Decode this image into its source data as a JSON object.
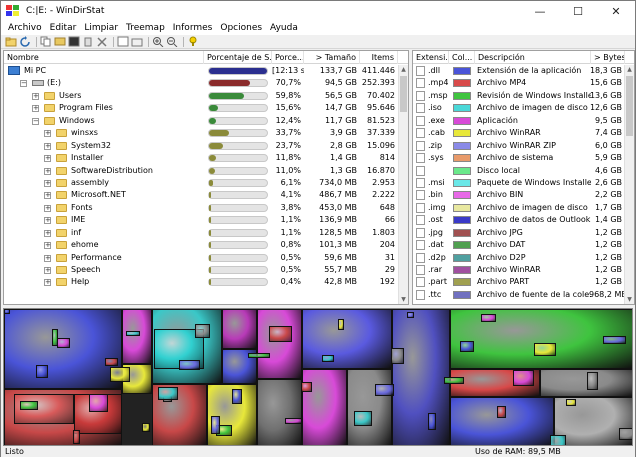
{
  "window": {
    "title": "C:|E: - WinDirStat",
    "minimize": "—",
    "maximize": "☐",
    "close": "✕"
  },
  "menu": [
    "Archivo",
    "Editar",
    "Limpiar",
    "Treemap",
    "Informes",
    "Opciones",
    "Ayuda"
  ],
  "toolbar": {
    "icons": [
      "open-icon",
      "refresh-icon",
      "copy-icon",
      "explorer-icon",
      "cmd-icon",
      "delete-recycle-icon",
      "delete-icon",
      "properties-icon",
      "new-folder-icon",
      "zoom-in-icon",
      "zoom-out-icon",
      "help-icon"
    ]
  },
  "left": {
    "columns": [
      "Nombre",
      "Porcentaje de S...",
      "Porce...",
      "> Tamaño",
      "Items"
    ],
    "rows": [
      {
        "name": "Mi PC",
        "level": 0,
        "icon": "pc",
        "exp": "",
        "perc_text": "[12:13 s]",
        "size": "133,7 GB",
        "items": "411.446",
        "bar": 1.0,
        "bar_color": "#2b2f8f"
      },
      {
        "name": "(E:)",
        "level": 1,
        "icon": "drive",
        "exp": "-",
        "perc_text": "70,7%",
        "size": "94,5 GB",
        "items": "252.393",
        "bar": 0.707,
        "bar_color": "#8b2b2b"
      },
      {
        "name": "Users",
        "level": 2,
        "icon": "folder",
        "exp": "+",
        "perc_text": "59,8%",
        "size": "56,5 GB",
        "items": "70.402",
        "bar": 0.598,
        "bar_color": "#3a8a3a"
      },
      {
        "name": "Program Files",
        "level": 2,
        "icon": "folder",
        "exp": "+",
        "perc_text": "15,6%",
        "size": "14,7 GB",
        "items": "95.646",
        "bar": 0.156,
        "bar_color": "#3a8a3a"
      },
      {
        "name": "Windows",
        "level": 2,
        "icon": "folder",
        "exp": "-",
        "perc_text": "12,4%",
        "size": "11,7 GB",
        "items": "81.523",
        "bar": 0.124,
        "bar_color": "#3a8a3a"
      },
      {
        "name": "winsxs",
        "level": 3,
        "icon": "folder",
        "exp": "+",
        "perc_text": "33,7%",
        "size": "3,9 GB",
        "items": "37.339",
        "bar": 0.337,
        "bar_color": "#8b8b3a"
      },
      {
        "name": "System32",
        "level": 3,
        "icon": "folder",
        "exp": "+",
        "perc_text": "23,7%",
        "size": "2,8 GB",
        "items": "15.096",
        "bar": 0.237,
        "bar_color": "#8b8b3a"
      },
      {
        "name": "Installer",
        "level": 3,
        "icon": "folder",
        "exp": "+",
        "perc_text": "11,8%",
        "size": "1,4 GB",
        "items": "814",
        "bar": 0.118,
        "bar_color": "#8b8b3a"
      },
      {
        "name": "SoftwareDistribution",
        "level": 3,
        "icon": "folder",
        "exp": "+",
        "perc_text": "11,0%",
        "size": "1,3 GB",
        "items": "16.870",
        "bar": 0.11,
        "bar_color": "#8b8b3a"
      },
      {
        "name": "assembly",
        "level": 3,
        "icon": "folder",
        "exp": "+",
        "perc_text": "6,1%",
        "size": "734,0 MB",
        "items": "2.953",
        "bar": 0.061,
        "bar_color": "#8b8b3a"
      },
      {
        "name": "Microsoft.NET",
        "level": 3,
        "icon": "folder",
        "exp": "+",
        "perc_text": "4,1%",
        "size": "486,7 MB",
        "items": "2.222",
        "bar": 0.041,
        "bar_color": "#8b8b3a"
      },
      {
        "name": "Fonts",
        "level": 3,
        "icon": "fonts",
        "exp": "+",
        "perc_text": "3,8%",
        "size": "453,0 MB",
        "items": "648",
        "bar": 0.038,
        "bar_color": "#8b8b3a"
      },
      {
        "name": "IME",
        "level": 3,
        "icon": "folder",
        "exp": "+",
        "perc_text": "1,1%",
        "size": "136,9 MB",
        "items": "66",
        "bar": 0.011,
        "bar_color": "#8b8b3a"
      },
      {
        "name": "inf",
        "level": 3,
        "icon": "folder",
        "exp": "+",
        "perc_text": "1,1%",
        "size": "128,5 MB",
        "items": "1.803",
        "bar": 0.011,
        "bar_color": "#8b8b3a"
      },
      {
        "name": "ehome",
        "level": 3,
        "icon": "folder",
        "exp": "+",
        "perc_text": "0,8%",
        "size": "101,3 MB",
        "items": "204",
        "bar": 0.008,
        "bar_color": "#8b8b3a"
      },
      {
        "name": "Performance",
        "level": 3,
        "icon": "folder",
        "exp": "+",
        "perc_text": "0,5%",
        "size": "59,6 MB",
        "items": "31",
        "bar": 0.005,
        "bar_color": "#8b8b3a"
      },
      {
        "name": "Speech",
        "level": 3,
        "icon": "folder",
        "exp": "+",
        "perc_text": "0,5%",
        "size": "55,7 MB",
        "items": "29",
        "bar": 0.005,
        "bar_color": "#8b8b3a"
      },
      {
        "name": "Help",
        "level": 3,
        "icon": "folder",
        "exp": "+",
        "perc_text": "0,4%",
        "size": "42,8 MB",
        "items": "192",
        "bar": 0.004,
        "bar_color": "#8b8b3a"
      }
    ]
  },
  "right": {
    "columns": [
      "Extensi...",
      "Col...",
      "Descripción",
      "> Bytes"
    ],
    "rows": [
      {
        "ext": ".dll",
        "color": "#4a54d8",
        "desc": "Extensión de la aplicación",
        "bytes": "18,3 GB"
      },
      {
        "ext": ".mp4",
        "color": "#d84a4a",
        "desc": "Archivo MP4",
        "bytes": "15,6 GB"
      },
      {
        "ext": ".msp",
        "color": "#3fc43f",
        "desc": "Revisión de Windows Installer",
        "bytes": "13,6 GB"
      },
      {
        "ext": ".iso",
        "color": "#4ad8d8",
        "desc": "Archivo de imagen de disco",
        "bytes": "12,6 GB"
      },
      {
        "ext": ".exe",
        "color": "#d84ad8",
        "desc": "Aplicación",
        "bytes": "9,5 GB"
      },
      {
        "ext": ".cab",
        "color": "#e8e83a",
        "desc": "Archivo WinRAR",
        "bytes": "7,4 GB"
      },
      {
        "ext": ".zip",
        "color": "#8a8ae8",
        "desc": "Archivo WinRAR ZIP",
        "bytes": "6,0 GB"
      },
      {
        "ext": ".sys",
        "color": "#e89a6a",
        "desc": "Archivo de sistema",
        "bytes": "5,9 GB"
      },
      {
        "ext": "",
        "color": "#6ae88a",
        "desc": "Disco local",
        "bytes": "4,6 GB"
      },
      {
        "ext": ".msi",
        "color": "#6ae8e8",
        "desc": "Paquete de Windows Installer",
        "bytes": "2,6 GB"
      },
      {
        "ext": ".bin",
        "color": "#e86ae8",
        "desc": "Archivo BIN",
        "bytes": "2,2 GB"
      },
      {
        "ext": ".img",
        "color": "#e8e8a0",
        "desc": "Archivo de imagen de disco",
        "bytes": "1,7 GB"
      },
      {
        "ext": ".ost",
        "color": "#3a3ac8",
        "desc": "Archivo de datos de Outlook",
        "bytes": "1,4 GB"
      },
      {
        "ext": ".jpg",
        "color": "#a05050",
        "desc": "Archivo JPG",
        "bytes": "1,2 GB"
      },
      {
        "ext": ".dat",
        "color": "#50a050",
        "desc": "Archivo DAT",
        "bytes": "1,2 GB"
      },
      {
        "ext": ".d2p",
        "color": "#50a0a0",
        "desc": "Archivo D2P",
        "bytes": "1,2 GB"
      },
      {
        "ext": ".rar",
        "color": "#a050a0",
        "desc": "Archivo WinRAR",
        "bytes": "1,2 GB"
      },
      {
        "ext": ".part",
        "color": "#a0a050",
        "desc": "Archivo PART",
        "bytes": "1,2 GB"
      },
      {
        "ext": ".ttc",
        "color": "#7070c0",
        "desc": "Archivo de fuente de la cole...",
        "bytes": "968,2 MB"
      }
    ]
  },
  "status": {
    "left": "Listo",
    "ram_label": "Uso de RAM:",
    "ram_value": "89,5 MB"
  }
}
